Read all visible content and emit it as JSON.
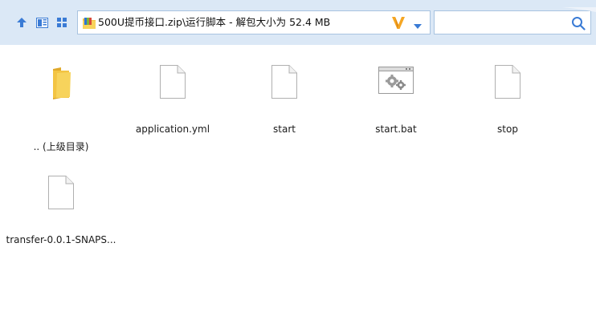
{
  "toolbar": {
    "address": "500U提币接口.zip\\运行脚本 - 解包大小为 52.4 MB",
    "search_placeholder": "",
    "icons": [
      "up-arrow-icon",
      "view-mode-icon",
      "grid-view-icon",
      "zip-folder-icon",
      "v-logo-icon",
      "dropdown-arrow-icon",
      "search-icon"
    ]
  },
  "files": [
    {
      "name": ".. (上级目录)",
      "kind": "folder-up",
      "icon": "folder-icon"
    },
    {
      "name": "application.yml",
      "kind": "file",
      "icon": "blank-file-icon"
    },
    {
      "name": "start",
      "kind": "file",
      "icon": "blank-file-icon"
    },
    {
      "name": "start.bat",
      "kind": "batch",
      "icon": "batch-file-icon"
    },
    {
      "name": "stop",
      "kind": "file",
      "icon": "blank-file-icon"
    },
    {
      "name": "transfer-0.0.1-SNAPS...",
      "kind": "file",
      "icon": "blank-file-icon"
    }
  ],
  "colors": {
    "toolbar_bg": "#dbe8f6",
    "accent_blue": "#3a7bd5",
    "v_logo": "#f5a623",
    "folder": "#f3c443"
  }
}
